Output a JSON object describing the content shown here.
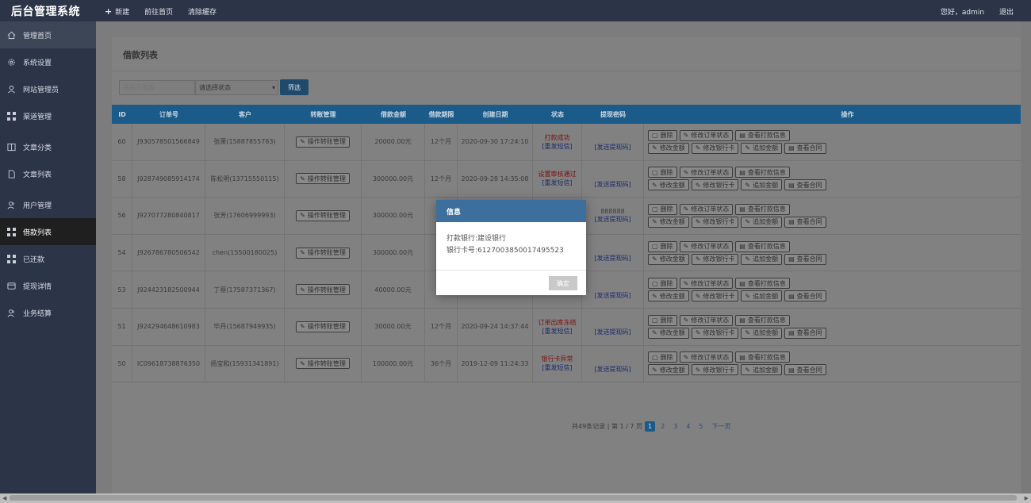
{
  "app": {
    "title": "后台管理系统",
    "nav": {
      "new_label": "新建",
      "home_label": "前往首页",
      "clear_cache_label": "清除缓存"
    },
    "user": {
      "greeting": "您好，admin",
      "logout_label": "退出"
    }
  },
  "sidebar": {
    "items": [
      {
        "label": "管理首页",
        "icon": "home-icon"
      },
      {
        "label": "系统设置",
        "icon": "gear-icon"
      },
      {
        "label": "网站管理员",
        "icon": "user-icon"
      },
      {
        "label": "渠道管理",
        "icon": "grid-icon"
      },
      {
        "label": "文章分类",
        "icon": "book-icon"
      },
      {
        "label": "文章列表",
        "icon": "file-icon"
      },
      {
        "label": "用户管理",
        "icon": "users-icon"
      },
      {
        "label": "借款列表",
        "icon": "grid-icon"
      },
      {
        "label": "已还款",
        "icon": "grid-icon"
      },
      {
        "label": "提现详情",
        "icon": "wallet-icon"
      },
      {
        "label": "业务结算",
        "icon": "users-icon"
      }
    ]
  },
  "page": {
    "title": "借款列表",
    "filters": {
      "phone_placeholder": "手机号搜索",
      "status_select": "请选择状态",
      "filter_button": "筛选"
    }
  },
  "table": {
    "headers": [
      "ID",
      "订单号",
      "客户",
      "转账管理",
      "借款金额",
      "借款期限",
      "创建日期",
      "状态",
      "提现密码",
      "操作"
    ],
    "transfer_button": "操作转账管理",
    "send_code_link": "[发送提现码]",
    "resend_sms": "[重发短信]",
    "op_labels": [
      "删除",
      "修改订单状态",
      "查看打款信息",
      "修改金额",
      "修改银行卡",
      "追加金额",
      "查看合同"
    ],
    "rows": [
      {
        "id": "60",
        "order": "J930578501566849",
        "customer": "张萧(15887855783)",
        "amount": "20000.00元",
        "term": "12个月",
        "date": "2020-09-30 17:24:10",
        "status": "打款成功",
        "code": ""
      },
      {
        "id": "58",
        "order": "J928749085914174",
        "customer": "陈松明(13715550115)",
        "amount": "300000.00元",
        "term": "12个月",
        "date": "2020-09-28 14:35:08",
        "status": "设置审核通过",
        "code": ""
      },
      {
        "id": "56",
        "order": "J927077280840817",
        "customer": "张芳(17606999993)",
        "amount": "300000.00元",
        "term": "",
        "date": "",
        "status": "",
        "code": "888888"
      },
      {
        "id": "54",
        "order": "J926786780506542",
        "customer": "chen(15500180025)",
        "amount": "300000.00元",
        "term": "",
        "date": "",
        "status": "",
        "code": ""
      },
      {
        "id": "53",
        "order": "J924423182500944",
        "customer": "丁蔡(17587371367)",
        "amount": "40000.00元",
        "term": "",
        "date": "",
        "status": "",
        "code": ""
      },
      {
        "id": "51",
        "order": "J924294648610983",
        "customer": "毕丹(15687949935)",
        "amount": "30000.00元",
        "term": "12个月",
        "date": "2020-09-24 14:37:44",
        "status": "订单出库冻结",
        "code": ""
      },
      {
        "id": "50",
        "order": "IC09618738876350",
        "customer": "扬宝和(15931341891)",
        "amount": "100000.00元",
        "term": "36个月",
        "date": "2019-12-09 11:24:33",
        "status": "银行卡异常",
        "code": ""
      }
    ]
  },
  "pagination": {
    "summary": "共49条记录 | 第 1 / 7 页",
    "pages": [
      "1",
      "2",
      "3",
      "4",
      "5"
    ],
    "next": "下一页"
  },
  "modal": {
    "title": "信息",
    "line1": "打款银行:建设银行",
    "line2": "银行卡号:6127003850017495523",
    "ok_label": "确定"
  }
}
